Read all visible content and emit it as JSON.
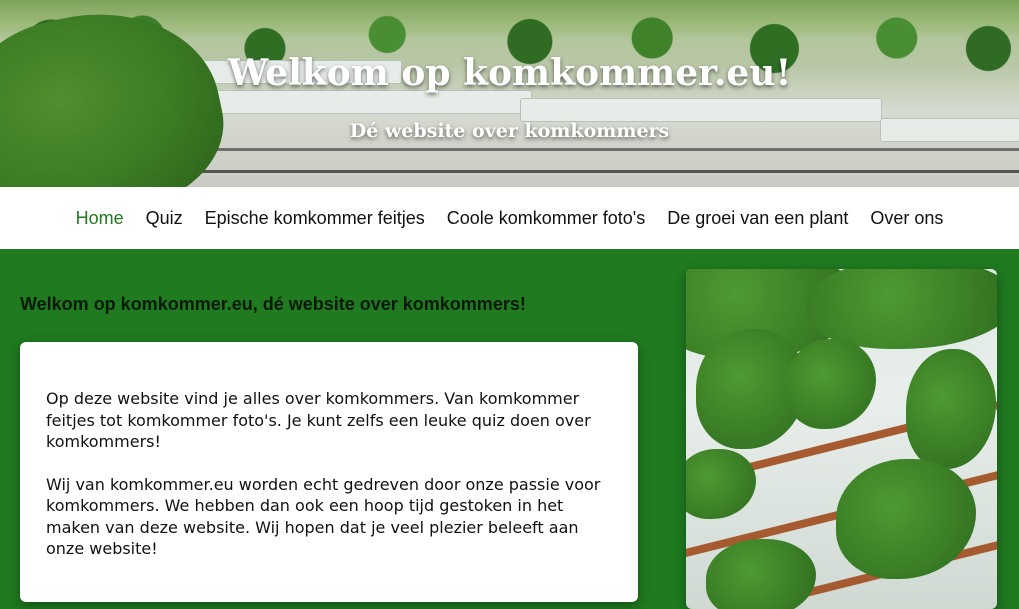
{
  "hero": {
    "title": "Welkom op komkommer.eu!",
    "subtitle": "Dé website over komkommers"
  },
  "nav": {
    "items": [
      {
        "label": "Home",
        "active": true
      },
      {
        "label": "Quiz",
        "active": false
      },
      {
        "label": "Epische komkommer feitjes",
        "active": false
      },
      {
        "label": "Coole komkommer foto's",
        "active": false
      },
      {
        "label": "De groei van een plant",
        "active": false
      },
      {
        "label": "Over ons",
        "active": false
      }
    ]
  },
  "main": {
    "heading": "Welkom op komkommer.eu, dé website over komkommers!",
    "paragraphs": [
      "Op deze website vind je alles over komkommers. Van komkommer feitjes tot komkommer foto's. Je kunt zelfs een leuke quiz doen over komkommers!",
      "Wij van komkommer.eu worden echt gedreven door onze passie voor komkommers. We hebben dan ook een hoop tijd gestoken in het maken van deze website. Wij hopen dat je veel plezier beleeft aan onze website!"
    ]
  },
  "colors": {
    "accent": "#1f7a20",
    "page_background": "#1f7a20",
    "nav_background": "#ffffff"
  }
}
